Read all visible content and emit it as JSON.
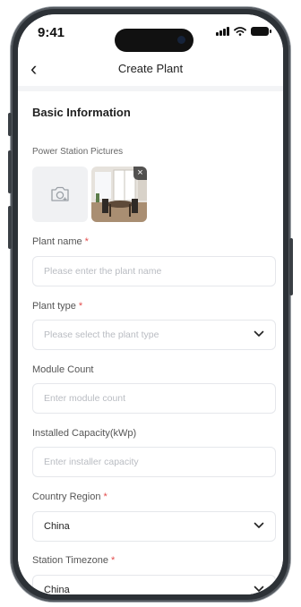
{
  "status_bar": {
    "time": "9:41"
  },
  "header": {
    "back_glyph": "‹",
    "title": "Create Plant"
  },
  "form": {
    "section_title": "Basic Information",
    "pictures_label": "Power Station Pictures",
    "required_mark": "*",
    "photo_close_glyph": "×",
    "plant_name": {
      "label": "Plant name",
      "placeholder": "Please enter the plant name"
    },
    "plant_type": {
      "label": "Plant type",
      "placeholder": "Please select the plant type"
    },
    "module_count": {
      "label": "Module Count",
      "placeholder": "Enter module count"
    },
    "installed_capacity": {
      "label": "Installed Capacity(kWp)",
      "placeholder": "Enter installer capacity"
    },
    "country_region": {
      "label": "Country Region",
      "value": "China"
    },
    "station_timezone": {
      "label": "Station Timezone",
      "value": "China"
    }
  },
  "icons": {
    "back": "chevron-left-icon",
    "camera": "camera-icon",
    "close": "close-icon",
    "dropdown": "chevron-down-icon",
    "signal": "signal-icon",
    "wifi": "wifi-icon",
    "battery": "battery-icon"
  },
  "colors": {
    "required": "#e34d4d",
    "page_background": "#f3f4f6",
    "placeholder": "#b9bcc2",
    "border": "#e5e7eb"
  }
}
